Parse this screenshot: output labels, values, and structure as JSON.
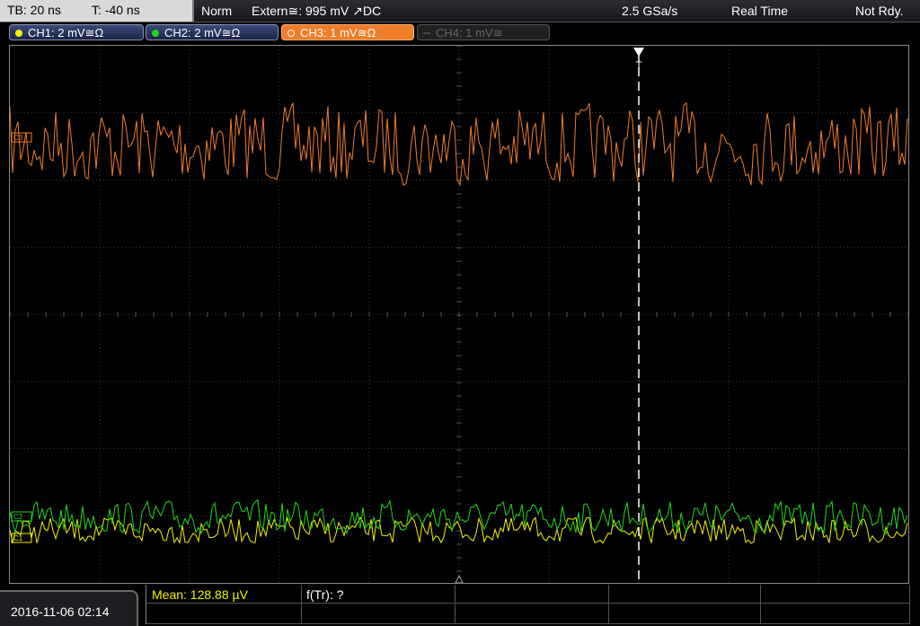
{
  "topbar": {
    "timebase": "TB: 20 ns",
    "trigger_pos": "T: -40 ns",
    "trigger_mode": "Norm",
    "trigger_source": "Extern≅: 995 mV ↗DC",
    "sample_rate": "2.5 GSa/s",
    "acq_mode": "Real Time",
    "status": "Not Rdy."
  },
  "channels": [
    {
      "label": "CH1: 2 mV≅Ω",
      "color": "#f2f200",
      "state": "on"
    },
    {
      "label": "CH2: 2 mV≅Ω",
      "color": "#22d61c",
      "state": "on"
    },
    {
      "label": "CH3: 1 mV≅Ω",
      "color": "#f07d2a",
      "state": "selected"
    },
    {
      "label": "CH4: 1 mV≅",
      "color": "#555555",
      "state": "off"
    }
  ],
  "screen": {
    "marker_ch3": "C3",
    "marker_ch2": "C2",
    "marker_ch1": "C1",
    "trigger_marker": "T"
  },
  "footer": {
    "datetime": "2016-11-06 02:14",
    "mean": "Mean: 128.88 µV",
    "frequency": "f(Tr): ?"
  },
  "colors": {
    "ch1": "#f2f200",
    "ch2": "#22d61c",
    "ch3": "#f07d2a",
    "grid": "#3a3a3a"
  },
  "icons": {
    "trigger_arrow": "trigger-down-arrow-icon",
    "ground_marker": "ground-triangle-icon"
  }
}
